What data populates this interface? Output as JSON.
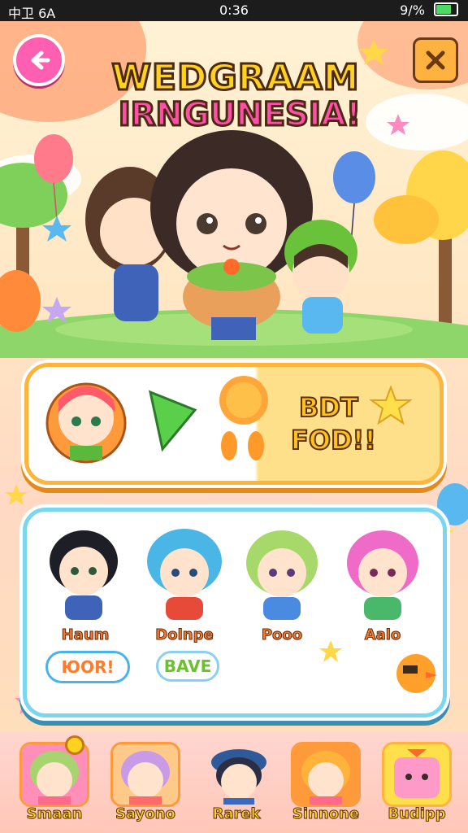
{
  "status_bar": {
    "left": "中卫 6A",
    "time": "0:36",
    "battery": "9/%"
  },
  "title": {
    "line1": "WEDGRAAM",
    "line2": "IRNGUNESIA!"
  },
  "buttons": {
    "back_icon": "arrow-left-icon",
    "close_icon": "close-icon"
  },
  "food_panel": {
    "text_line1": "BDT",
    "text_line2": "FOD!!"
  },
  "characters": [
    {
      "name": "Haum",
      "hair": "#1e1e26"
    },
    {
      "name": "Dolnpe",
      "hair": "#49b6e6"
    },
    {
      "name": "Pooo",
      "hair": "#a6d96a"
    },
    {
      "name": "Aalo",
      "hair": "#ee6bc7"
    }
  ],
  "bubbles": {
    "b1": "ЮОR!",
    "b2": "BAVE"
  },
  "tabs": [
    {
      "label": "Smaan",
      "hair": "#a8d46f"
    },
    {
      "label": "Sayono",
      "hair": "#c99be6"
    },
    {
      "label": "Rarek",
      "hair": "#2b2f45"
    },
    {
      "label": "Sinnone",
      "hair": "#ffb33a"
    },
    {
      "label": "Budipp",
      "hair": "#ff7fb8"
    }
  ],
  "colors": {
    "accent_pink": "#ff4fa8",
    "accent_yellow": "#ffd21f",
    "panel_orange": "#ffb53b",
    "panel_blue": "#7ad7f0"
  }
}
